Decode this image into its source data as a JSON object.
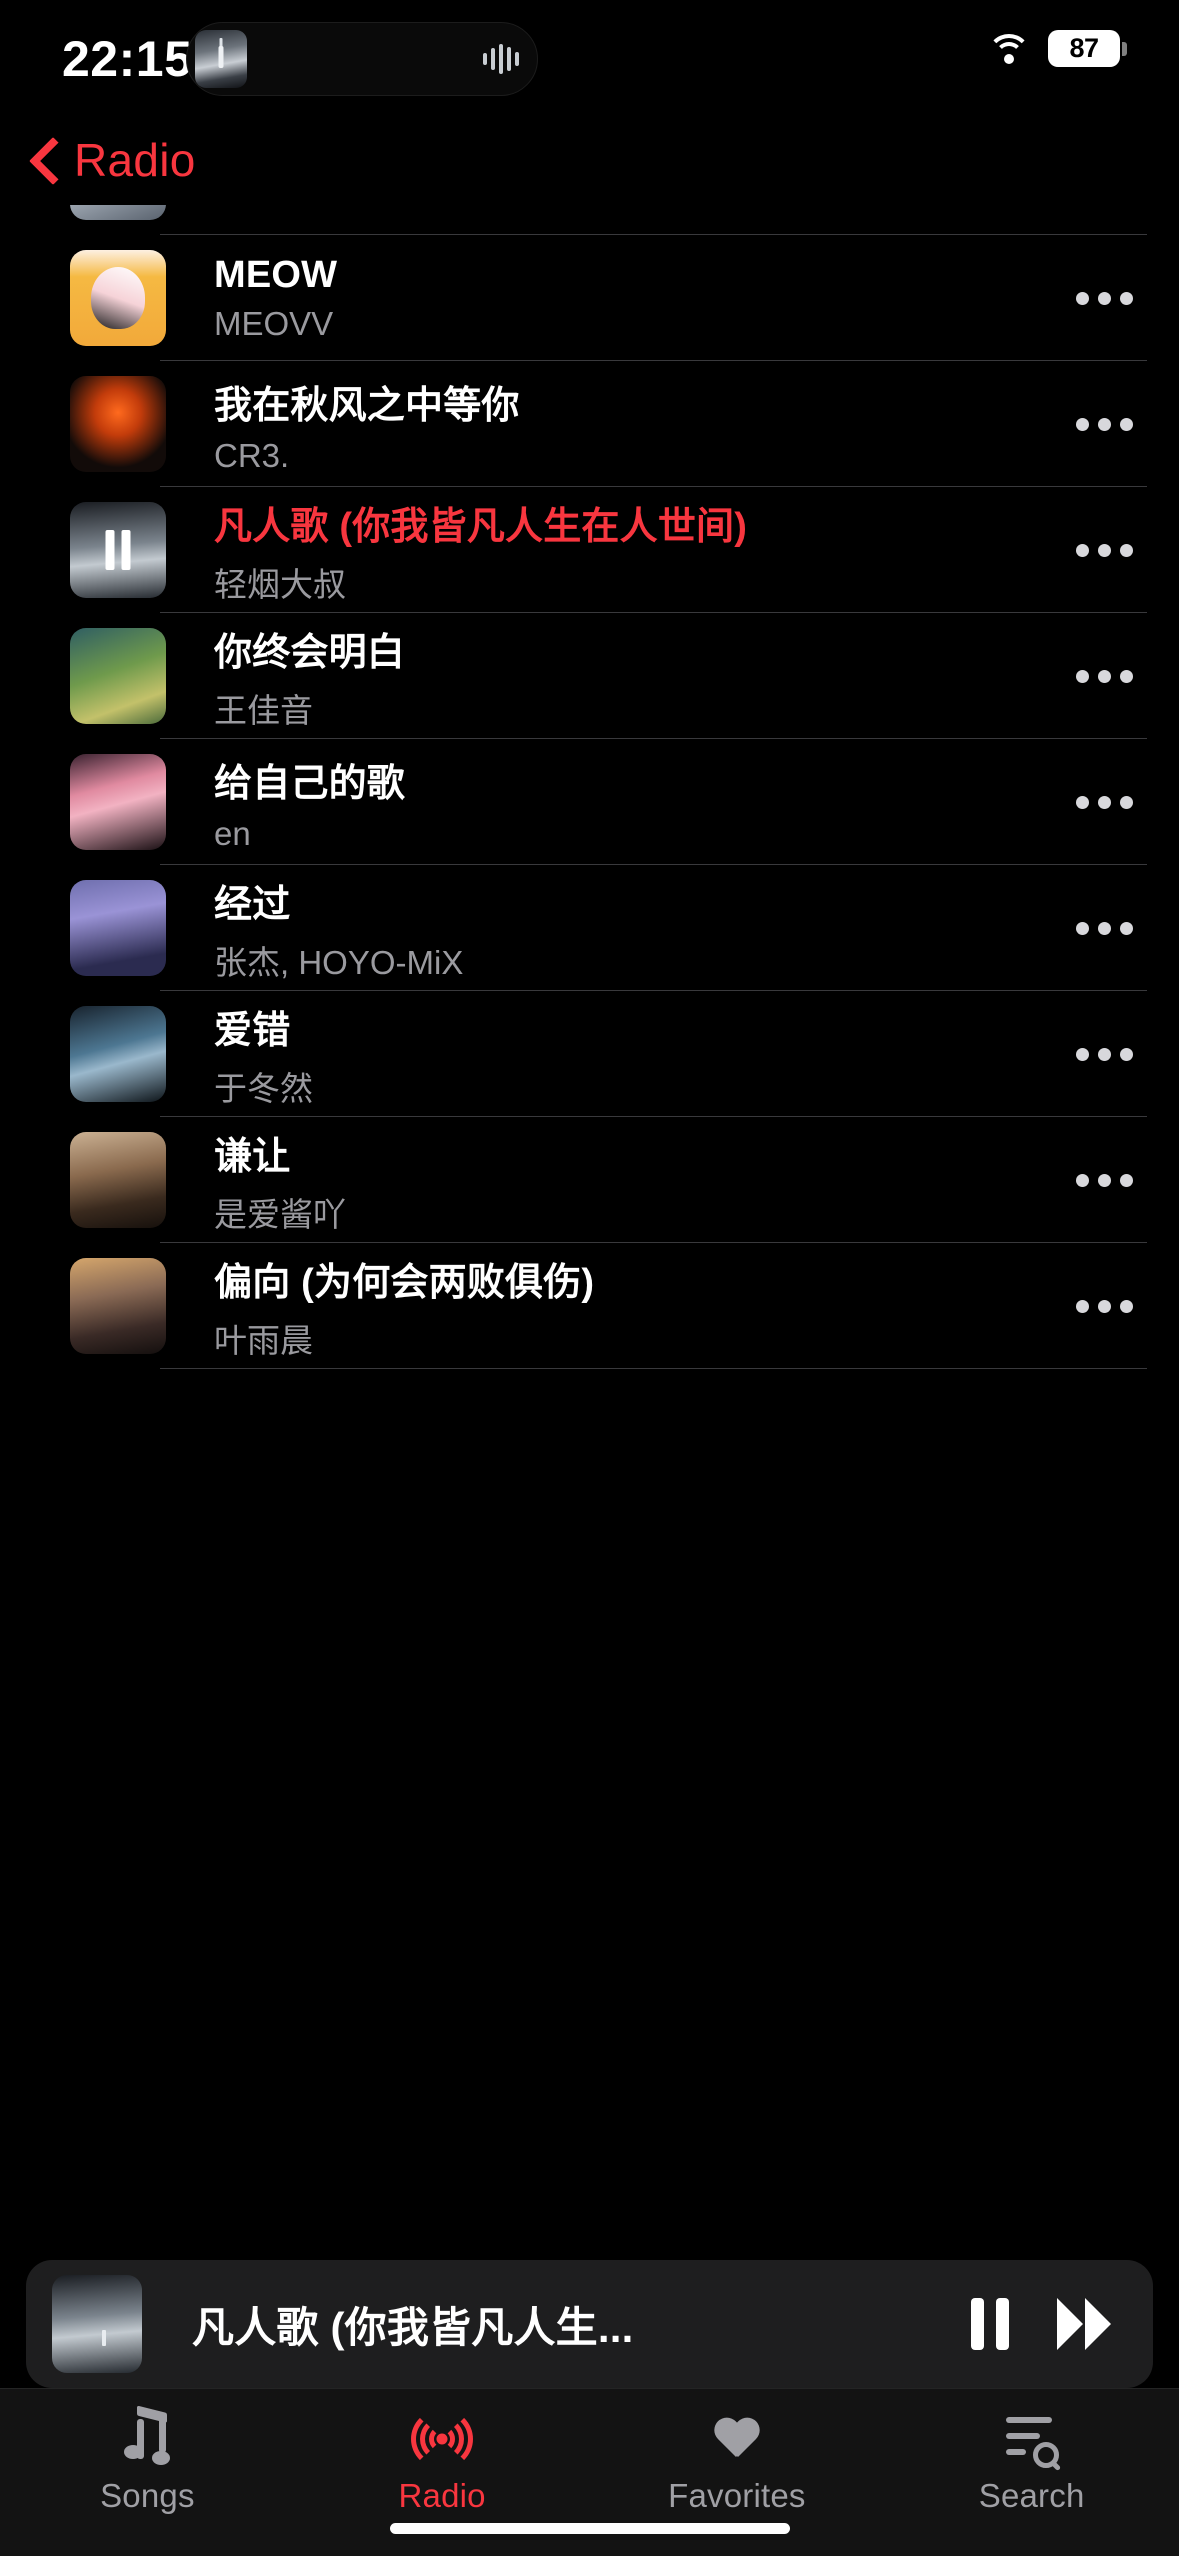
{
  "status_bar": {
    "time": "22:15",
    "battery_percent": "87",
    "wifi_icon": "wifi-icon",
    "dynamic_island": {
      "album_art_icon": "now-playing-artwork",
      "waveform_icon": "audio-waveform-icon"
    }
  },
  "nav": {
    "back_icon": "chevron-left-icon",
    "back_label": "Radio"
  },
  "accent_color": "#F8363F",
  "songs": [
    {
      "title": "",
      "artist": "",
      "art": "a-crowd",
      "playing": false,
      "menu_icon": "ellipsis-icon"
    },
    {
      "title": "MEOW",
      "artist": "MEOVV",
      "art": "a-meow",
      "playing": false,
      "menu_icon": "ellipsis-icon"
    },
    {
      "title": "我在秋风之中等你",
      "artist": "CR3.",
      "art": "a-autumn",
      "playing": false,
      "menu_icon": "ellipsis-icon"
    },
    {
      "title": "凡人歌 (你我皆凡人生在人世间)",
      "artist": "轻烟大叔",
      "art": "a-fanren",
      "playing": true,
      "menu_icon": "ellipsis-icon"
    },
    {
      "title": "你终会明白",
      "artist": "王佳音",
      "art": "a-green",
      "playing": false,
      "menu_icon": "ellipsis-icon"
    },
    {
      "title": "给自己的歌",
      "artist": "en",
      "art": "a-pink",
      "playing": false,
      "menu_icon": "ellipsis-icon"
    },
    {
      "title": "经过",
      "artist": "张杰, HOYO-MiX",
      "art": "a-anime",
      "playing": false,
      "menu_icon": "ellipsis-icon"
    },
    {
      "title": "爱错",
      "artist": "于冬然",
      "art": "a-blue",
      "playing": false,
      "menu_icon": "ellipsis-icon"
    },
    {
      "title": "谦让",
      "artist": "是爱酱吖",
      "art": "a-sunset",
      "playing": false,
      "menu_icon": "ellipsis-icon"
    },
    {
      "title": "偏向 (为何会两败俱伤)",
      "artist": "叶雨晨",
      "art": "a-portrait",
      "playing": false,
      "menu_icon": "ellipsis-icon"
    }
  ],
  "mini_player": {
    "title": "凡人歌 (你我皆凡人生...",
    "artwork_icon": "mini-player-artwork",
    "pause_icon": "pause-icon",
    "forward_icon": "fast-forward-icon"
  },
  "tabs": [
    {
      "label": "Songs",
      "icon": "music-note-icon",
      "active": false
    },
    {
      "label": "Radio",
      "icon": "radio-waves-icon",
      "active": true
    },
    {
      "label": "Favorites",
      "icon": "heart-icon",
      "active": false
    },
    {
      "label": "Search",
      "icon": "search-list-icon",
      "active": false
    }
  ]
}
